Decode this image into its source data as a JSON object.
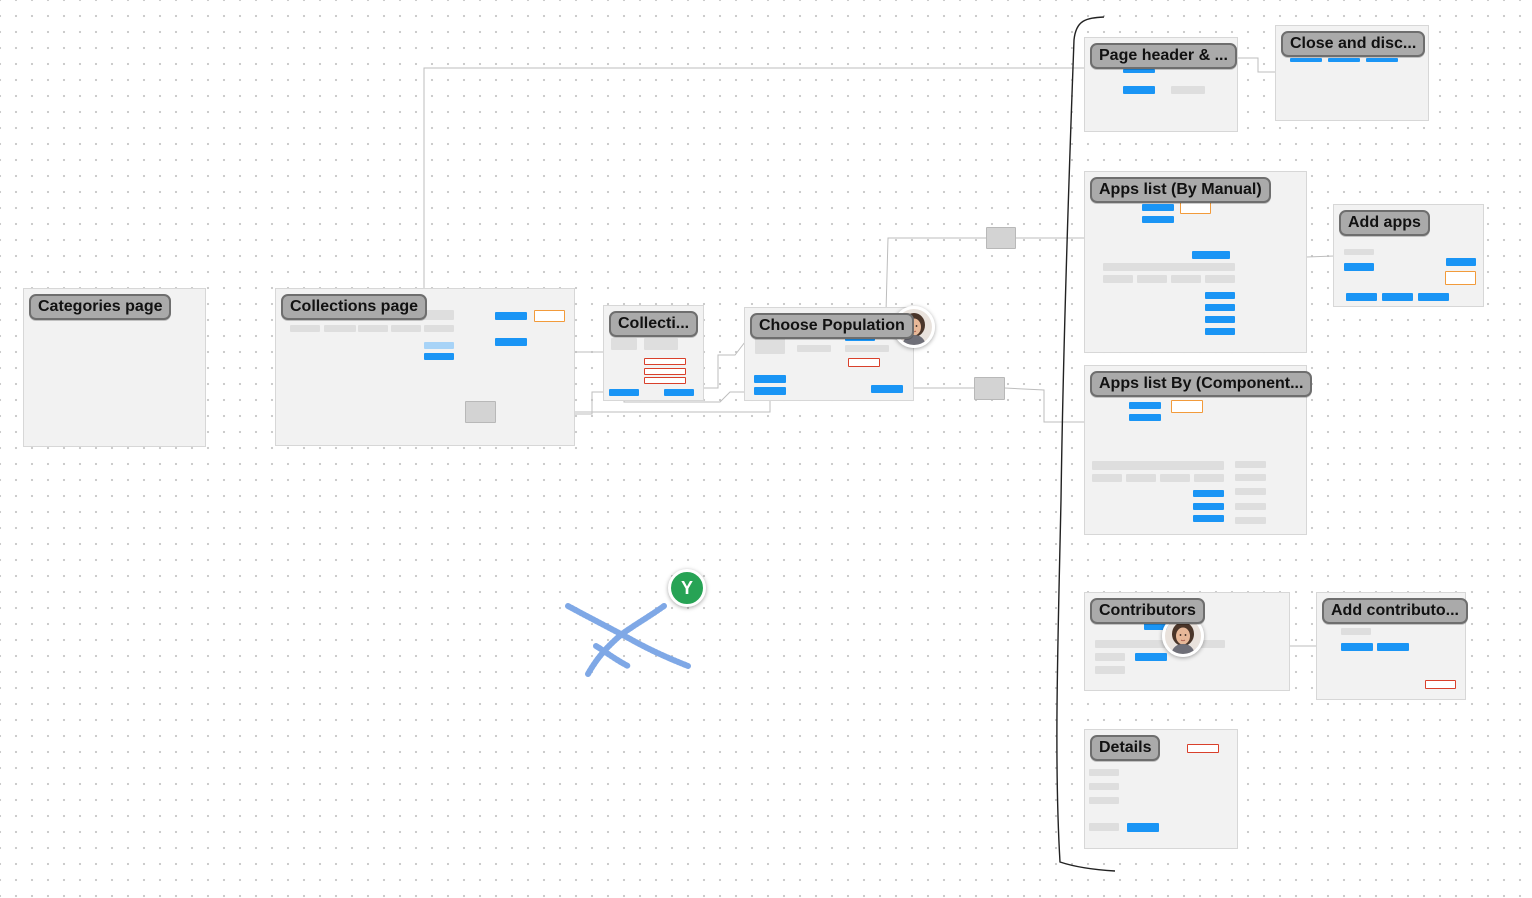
{
  "app": {
    "name": "FigJam board"
  },
  "frames": {
    "categories_page": "Categories page",
    "collections_page": "Collections page",
    "collections_short": "Collecti...",
    "choose_population": "Choose Population",
    "page_header": "Page header & ...",
    "close_and_discard": "Close and disc...",
    "apps_list_manual": "Apps list (By Manual)",
    "add_apps": "Add apps",
    "apps_list_component": "Apps list By (Component...",
    "contributors": "Contributors",
    "add_contributors": "Add contributo...",
    "details": "Details"
  },
  "collaborators": {
    "cursor_initial": "Y"
  },
  "icons": {
    "avatar_a": "user-avatar-icon",
    "avatar_b": "user-avatar-icon",
    "scribble": "freehand-scribble-icon"
  },
  "colors": {
    "canvas": "#ffffff",
    "frame_fill": "#f2f2f2",
    "title_bg": "#aaaaaa",
    "accent_blue": "#1a95f5",
    "orange_outline": "#f29b3b",
    "red_outline": "#d9402b",
    "cursor_green": "#27a355",
    "scribble_blue": "#7fa8e6"
  }
}
